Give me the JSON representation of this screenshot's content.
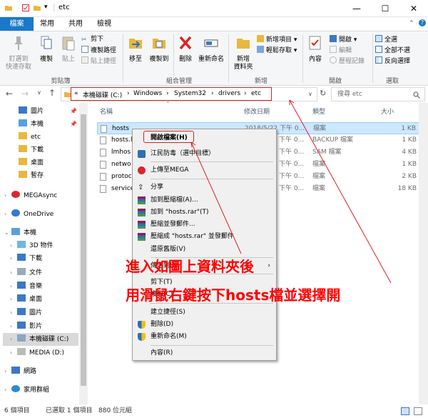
{
  "window": {
    "title": "etc"
  },
  "tabs": [
    "檔案",
    "常用",
    "共用",
    "檢視"
  ],
  "ribbon": {
    "clipboard": {
      "pin_label_1": "釘選到",
      "pin_label_2": "快速存取",
      "copy_label": "複製",
      "paste_label": "貼上",
      "cut_label": "剪下",
      "copy_path_label": "複製路徑",
      "paste_shortcut_label": "貼上捷徑",
      "group_label": "剪貼簿"
    },
    "organize": {
      "move_to_1": "移至",
      "copy_to_1": "複製到",
      "delete_label": "刪除",
      "rename_label": "重新命名",
      "group_label": "組合管理"
    },
    "new": {
      "new_folder_1": "新增",
      "new_folder_2": "資料夾",
      "new_item_label": "新增項目",
      "easy_access_label": "輕鬆存取",
      "group_label": "新增"
    },
    "open": {
      "properties_label": "內容",
      "open_label": "開啟",
      "edit_label": "編輯",
      "history_label": "歷程記錄",
      "group_label": "開啟"
    },
    "select": {
      "select_all_label": "全選",
      "select_none_label": "全部不選",
      "invert_label": "反向選擇",
      "group_label": "選取"
    }
  },
  "address": {
    "prefix": "«",
    "crumbs": [
      "本機磁碟 (C:)",
      "Windows",
      "System32",
      "drivers",
      "etc"
    ],
    "separator": "›",
    "search_placeholder": "搜尋 etc"
  },
  "navpane": {
    "items": [
      {
        "label": "圖片",
        "icon": "pictures-icon",
        "pinned": true
      },
      {
        "label": "本機",
        "icon": "pc-icon",
        "pinned": true
      },
      {
        "label": "etc",
        "icon": "folder-icon",
        "pinned": false
      },
      {
        "label": "下載",
        "icon": "folder-icon",
        "pinned": false
      },
      {
        "label": "桌面",
        "icon": "folder-icon",
        "pinned": false
      },
      {
        "label": "暫存",
        "icon": "folder-icon",
        "pinned": false
      },
      {
        "label": "MEGAsync",
        "icon": "mega-icon",
        "pinned": false
      },
      {
        "label": "OneDrive",
        "icon": "onedrive-icon",
        "pinned": false
      },
      {
        "label": "本機",
        "icon": "pc-icon",
        "pinned": false
      },
      {
        "label": "3D 物件",
        "icon": "objects-icon",
        "pinned": false
      },
      {
        "label": "下載",
        "icon": "downloads-icon",
        "pinned": false
      },
      {
        "label": "文件",
        "icon": "documents-icon",
        "pinned": false
      },
      {
        "label": "音樂",
        "icon": "music-icon",
        "pinned": false
      },
      {
        "label": "桌面",
        "icon": "desktop-icon",
        "pinned": false
      },
      {
        "label": "圖片",
        "icon": "pictures-icon",
        "pinned": false
      },
      {
        "label": "影片",
        "icon": "videos-icon",
        "pinned": false
      },
      {
        "label": "本機磁碟 (C:)",
        "icon": "drive-icon",
        "pinned": false
      },
      {
        "label": "MEDIA (D:)",
        "icon": "drive-icon",
        "pinned": false
      },
      {
        "label": "網路",
        "icon": "network-icon",
        "pinned": false
      },
      {
        "label": "家用群組",
        "icon": "homegroup-icon",
        "pinned": false
      }
    ]
  },
  "columns": {
    "name": "名稱",
    "date": "修改日期",
    "type": "類型",
    "size": "大小"
  },
  "files": [
    {
      "name": "hosts",
      "date": "2018/5/22 下午 0...",
      "type": "檔案",
      "size": "1 KB"
    },
    {
      "name": "hosts.l",
      "date": "2018/5/22 下午 0...",
      "type": "BACKUP 檔案",
      "size": "1 KB"
    },
    {
      "name": "lmhos",
      "date": "2018/5/22 下午 0...",
      "type": "SAM 檔案",
      "size": "4 KB"
    },
    {
      "name": "netwo",
      "date": "2018/5/22 下午 0...",
      "type": "檔案",
      "size": "1 KB"
    },
    {
      "name": "protoc",
      "date": "2018/5/22 下午 0...",
      "type": "檔案",
      "size": "2 KB"
    },
    {
      "name": "service",
      "date": "2018/5/22 下午 0...",
      "type": "檔案",
      "size": "18 KB"
    }
  ],
  "context_menu": {
    "items": [
      {
        "label": "開啟檔案(H)",
        "icon": ""
      },
      {
        "label": "江民防毒（選中目標）",
        "icon": "antivirus-icon"
      },
      {
        "label": "上傳至MEGA",
        "icon": "mega-icon"
      },
      {
        "label": "分享",
        "icon": "share-icon"
      },
      {
        "label": "加到壓縮檔(A)...",
        "icon": "winrar-icon"
      },
      {
        "label": "加到 \"hosts.rar\"(T)",
        "icon": "winrar-icon"
      },
      {
        "label": "壓縮並發郵件...",
        "icon": "winrar-icon"
      },
      {
        "label": "壓縮成 \"hosts.rar\" 並發郵件",
        "icon": "winrar-icon"
      },
      {
        "label": "還原舊版(V)",
        "icon": ""
      },
      {
        "label": "傳送到(N)",
        "icon": ""
      },
      {
        "label": "剪下(T)",
        "icon": ""
      },
      {
        "label": "複製(C)",
        "icon": ""
      },
      {
        "label": "建立捷徑(S)",
        "icon": ""
      },
      {
        "label": "刪除(D)",
        "icon": "shield-icon"
      },
      {
        "label": "重新命名(M)",
        "icon": "shield-icon"
      },
      {
        "label": "內容(R)",
        "icon": ""
      }
    ]
  },
  "annotation": {
    "line1": "進入如圖上資料夾後",
    "line2": "用滑鼠右鍵按下hosts檔並選擇開",
    "color": "#ff0000"
  },
  "status": {
    "count": "6 個項目",
    "selected": "已選取 1 個項目",
    "size": "880 位元組"
  },
  "colors": {
    "accent": "#1979ca",
    "selection": "#cce8ff",
    "highlight": "#e02020"
  }
}
